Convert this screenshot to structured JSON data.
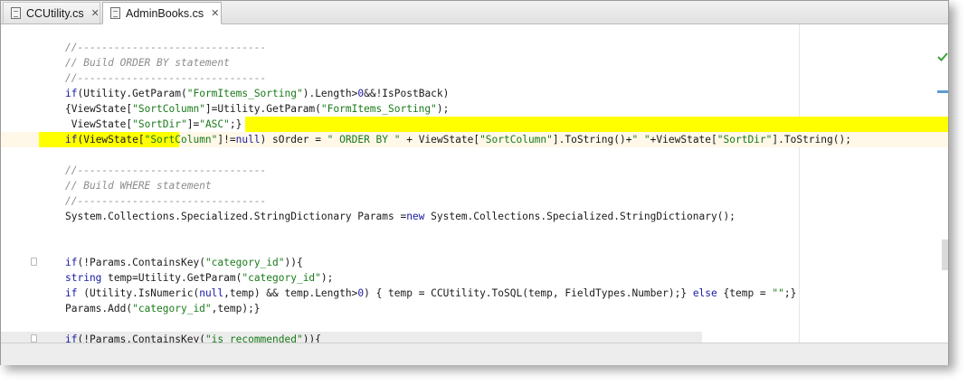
{
  "tabs": [
    {
      "label": "CCUtility.cs",
      "active": false,
      "close_icon": "close-icon"
    },
    {
      "label": "AdminBooks.cs",
      "active": true,
      "close_icon": "close-icon"
    }
  ],
  "code_lines": [
    {
      "t": "cmt",
      "text": "//-------------------------------"
    },
    {
      "t": "cmt",
      "text": "// Build ORDER BY statement"
    },
    {
      "t": "cmt",
      "text": "//-------------------------------"
    },
    {
      "t": "code",
      "text": "if(Utility.GetParam(\"FormItems_Sorting\").Length>0&&!IsPostBack)"
    },
    {
      "t": "code",
      "text": "{ViewState[\"SortColumn\"]=Utility.GetParam(\"FormItems_Sorting\");"
    },
    {
      "t": "code",
      "text": " ViewState[\"SortDir\"]=\"ASC\";}"
    },
    {
      "t": "code",
      "text": "if(ViewState[\"SortColumn\"]!=null) sOrder = \" ORDER BY \" + ViewState[\"SortColumn\"].ToString()+\" \"+ViewState[\"SortDir\"].ToString();"
    },
    {
      "t": "blank",
      "text": ""
    },
    {
      "t": "cmt",
      "text": "//-------------------------------"
    },
    {
      "t": "cmt",
      "text": "// Build WHERE statement"
    },
    {
      "t": "cmt",
      "text": "//-------------------------------"
    },
    {
      "t": "code",
      "text": "System.Collections.Specialized.StringDictionary Params =new System.Collections.Specialized.StringDictionary();"
    },
    {
      "t": "blank",
      "text": ""
    },
    {
      "t": "blank",
      "text": ""
    },
    {
      "t": "code",
      "text": "if(!Params.ContainsKey(\"category_id\")){"
    },
    {
      "t": "code",
      "text": "string temp=Utility.GetParam(\"category_id\");"
    },
    {
      "t": "code",
      "text": "if (Utility.IsNumeric(null,temp) && temp.Length>0) { temp = CCUtility.ToSQL(temp, FieldTypes.Number);} else {temp = \"\";}"
    },
    {
      "t": "code",
      "text": "Params.Add(\"category_id\",temp);}"
    },
    {
      "t": "blank",
      "text": ""
    },
    {
      "t": "code",
      "text": "if(!Params.ContainsKey(\"is_recommended\")){"
    }
  ],
  "status_icon": "check-icon"
}
